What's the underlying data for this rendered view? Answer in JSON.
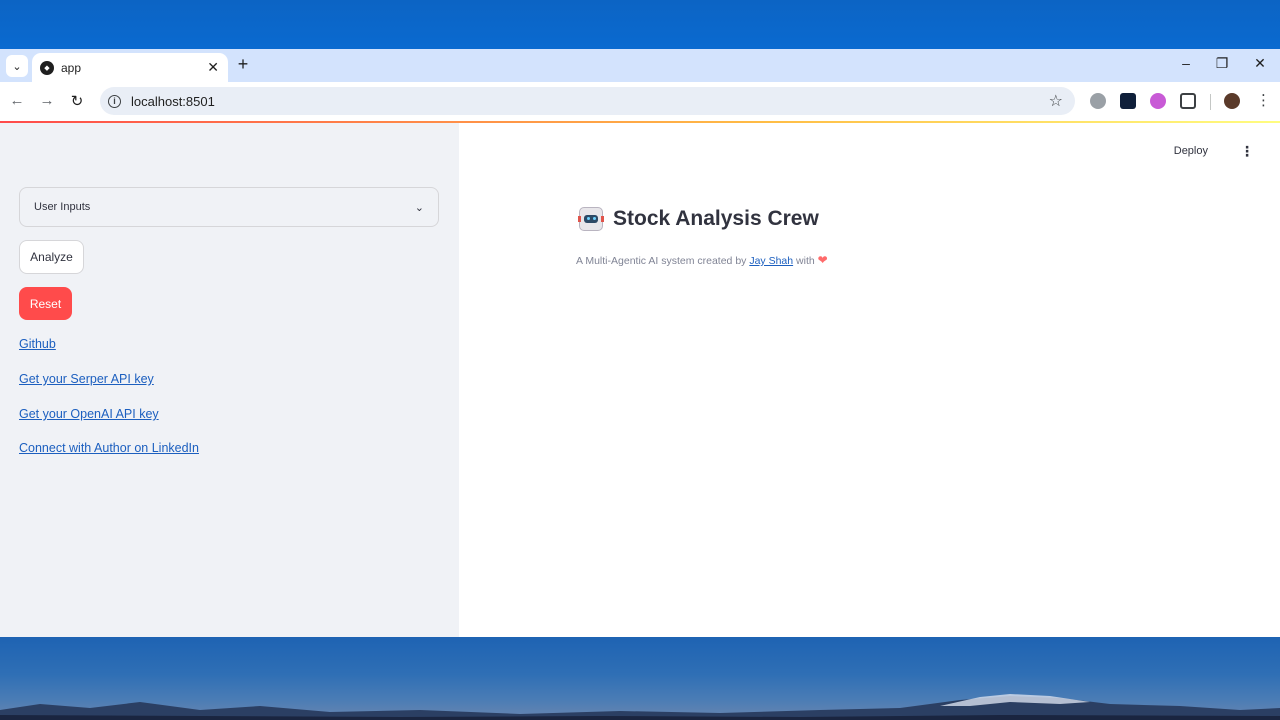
{
  "browser": {
    "tab_title": "app",
    "url": "localhost:8501"
  },
  "sidebar": {
    "expander_label": "User Inputs",
    "analyze_label": "Analyze",
    "reset_label": "Reset",
    "links": [
      "Github",
      "Get your Serper API key",
      "Get your OpenAI API key",
      "Connect with Author on LinkedIn"
    ]
  },
  "main": {
    "deploy_label": "Deploy",
    "title": "Stock Analysis Crew",
    "subtitle_prefix": "A Multi-Agentic AI system created by ",
    "author": "Jay Shah",
    "subtitle_suffix": " with "
  },
  "colors": {
    "accent": "#ff4b4b",
    "link": "#1c5fbf",
    "sidebar_bg": "#f0f2f6"
  },
  "icons": [
    "tab-list-icon",
    "app-favicon",
    "close-icon",
    "plus-icon",
    "minimize-icon",
    "restore-icon",
    "window-close-icon",
    "back-icon",
    "forward-icon",
    "reload-icon",
    "info-icon",
    "star-icon",
    "extension-icons",
    "puzzle-icon",
    "profile-avatar",
    "more-icon",
    "chevron-down-icon",
    "robot-icon",
    "heart-icon"
  ]
}
